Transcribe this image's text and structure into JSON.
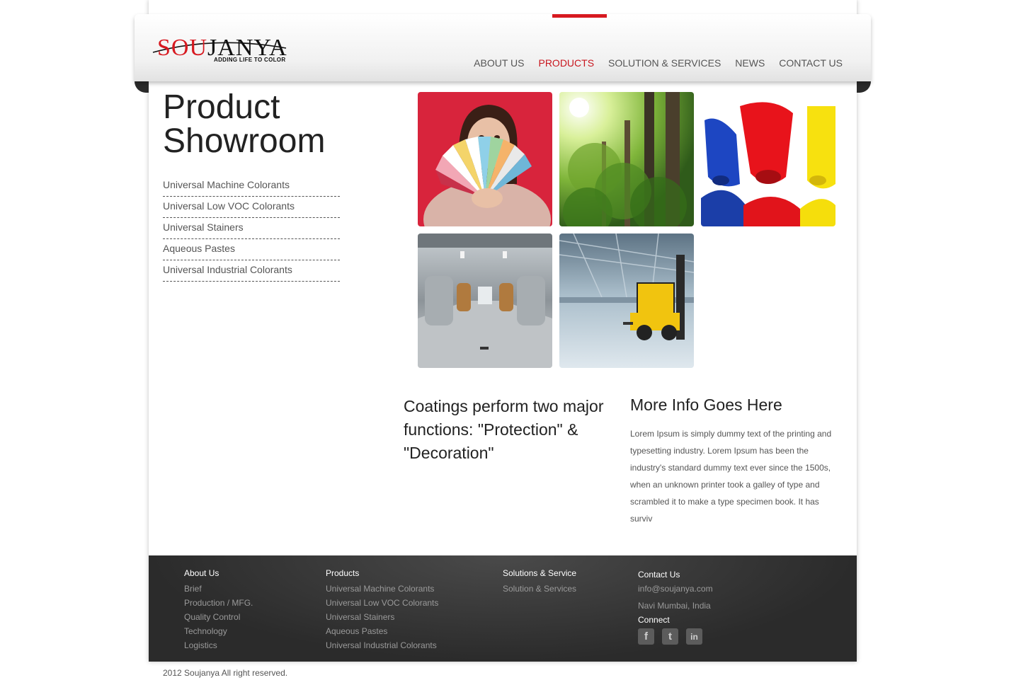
{
  "brand": {
    "name_prefix": "SOU",
    "name_suffix": "JANYA",
    "tagline": "ADDING LIFE TO COLOR",
    "accent_color": "#d71920"
  },
  "nav": {
    "items": [
      {
        "label": "ABOUT US"
      },
      {
        "label": "PRODUCTS",
        "active": true
      },
      {
        "label": "SOLUTION & SERVICES"
      },
      {
        "label": "NEWS"
      },
      {
        "label": "CONTACT US"
      }
    ]
  },
  "showroom": {
    "title_line1": "Product",
    "title_line2": "Showroom",
    "items": [
      "Universal Machine Colorants",
      "Universal Low VOC Colorants",
      "Universal Stainers",
      "Aqueous Pastes",
      "Universal Industrial Colorants"
    ]
  },
  "gallery": {
    "images": [
      "woman-holding-color-swatch-fan",
      "sunlit-forest-trees",
      "spilled-paint-bottles-blue-red-yellow",
      "industrial-tank-plant-interior",
      "yellow-forklift-in-warehouse"
    ]
  },
  "info": {
    "coatings_heading": "Coatings perform two major functions: \"Protection\" & \"Decoration\"",
    "more_heading": "More Info Goes Here",
    "more_body": "Lorem Ipsum is simply dummy text of the printing and typesetting industry. Lorem Ipsum has been the industry's standard dummy text ever since the 1500s, when an unknown printer took a galley of type and scrambled it to make a type specimen book. It has surviv"
  },
  "footer": {
    "about": {
      "heading": "About Us",
      "items": [
        "Brief",
        "Production / MFG.",
        "Quality Control",
        "Technology",
        "Logistics"
      ]
    },
    "products": {
      "heading": "Products",
      "items": [
        "Universal Machine Colorants",
        "Universal Low VOC Colorants",
        "Universal Stainers",
        "Aqueous Pastes",
        "Universal Industrial Colorants"
      ]
    },
    "solutions": {
      "heading": "Solutions & Service",
      "items": [
        "Solution & Services"
      ]
    },
    "contact": {
      "heading": "Contact Us",
      "email": "info@soujanya.com",
      "location": "Navi Mumbai, India",
      "connect_heading": "Connect",
      "social": [
        {
          "icon": "facebook-icon",
          "glyph": "f"
        },
        {
          "icon": "twitter-icon",
          "glyph": "t"
        },
        {
          "icon": "linkedin-icon",
          "glyph": "in"
        }
      ]
    }
  },
  "copyright": "2012 Soujanya All right reserved."
}
